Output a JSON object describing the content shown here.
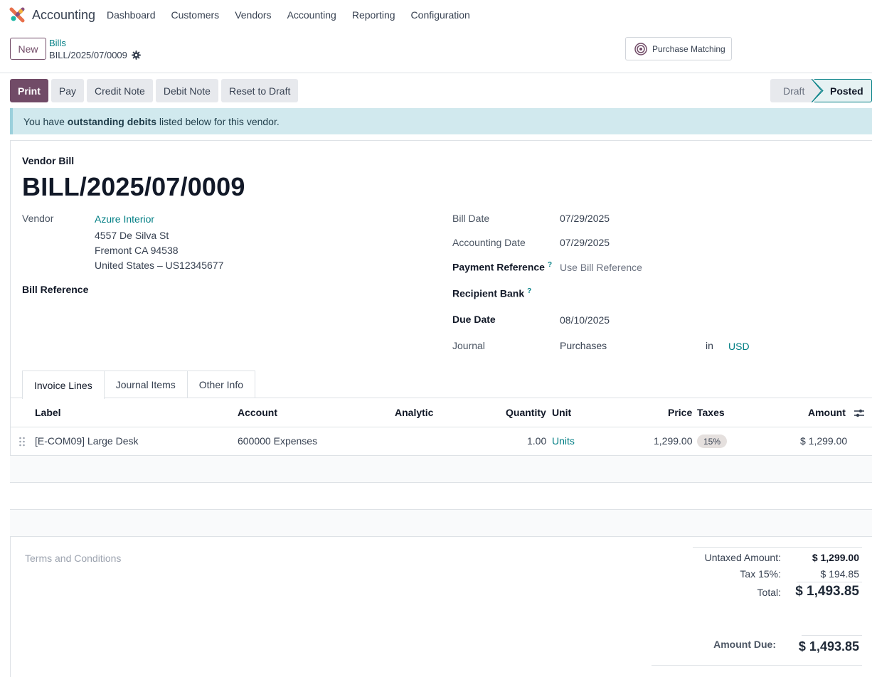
{
  "app": {
    "name": "Accounting",
    "menu": [
      "Dashboard",
      "Customers",
      "Vendors",
      "Accounting",
      "Reporting",
      "Configuration"
    ]
  },
  "control": {
    "new_label": "New",
    "breadcrumb_parent": "Bills",
    "breadcrumb_current": "BILL/2025/07/0009",
    "purchase_matching": "Purchase Matching"
  },
  "actions": {
    "print": "Print",
    "pay": "Pay",
    "credit_note": "Credit Note",
    "debit_note": "Debit Note",
    "reset_to_draft": "Reset to Draft"
  },
  "status": {
    "draft": "Draft",
    "posted": "Posted",
    "current": "Posted"
  },
  "alert": {
    "prefix": "You have ",
    "bold": "outstanding debits",
    "suffix": " listed below for this vendor."
  },
  "form": {
    "type_label": "Vendor Bill",
    "name": "BILL/2025/07/0009",
    "vendor_label": "Vendor",
    "vendor_name": "Azure Interior",
    "vendor_address_1": "4557 De Silva St",
    "vendor_address_2": "Fremont CA 94538",
    "vendor_address_3": "United States – US12345677",
    "bill_reference_label": "Bill Reference",
    "bill_date_label": "Bill Date",
    "bill_date": "07/29/2025",
    "accounting_date_label": "Accounting Date",
    "accounting_date": "07/29/2025",
    "payment_reference_label": "Payment Reference",
    "payment_reference_placeholder": "Use Bill Reference",
    "recipient_bank_label": "Recipient Bank",
    "due_date_label": "Due Date",
    "due_date": "08/10/2025",
    "journal_label": "Journal",
    "journal": "Purchases",
    "in_label": "in",
    "currency": "USD",
    "help_mark": "?"
  },
  "tabs": [
    "Invoice Lines",
    "Journal Items",
    "Other Info"
  ],
  "table": {
    "headers": {
      "label": "Label",
      "account": "Account",
      "analytic": "Analytic",
      "quantity": "Quantity",
      "unit": "Unit",
      "price": "Price",
      "taxes": "Taxes",
      "amount": "Amount"
    },
    "rows": [
      {
        "label": "[E-COM09] Large Desk",
        "account": "600000 Expenses",
        "quantity": "1.00",
        "unit": "Units",
        "price": "1,299.00",
        "tax": "15%",
        "amount": "$ 1,299.00"
      }
    ]
  },
  "terms_placeholder": "Terms and Conditions",
  "totals": {
    "untaxed_label": "Untaxed Amount:",
    "untaxed": "$ 1,299.00",
    "tax_label": "Tax 15%:",
    "tax": "$ 194.85",
    "total_label": "Total:",
    "total": "$ 1,493.85",
    "amount_due_label": "Amount Due:",
    "amount_due": "$ 1,493.85"
  },
  "colors": {
    "brand": "#714b67",
    "link": "#017e84",
    "alert_bg": "#d1e9ee"
  }
}
